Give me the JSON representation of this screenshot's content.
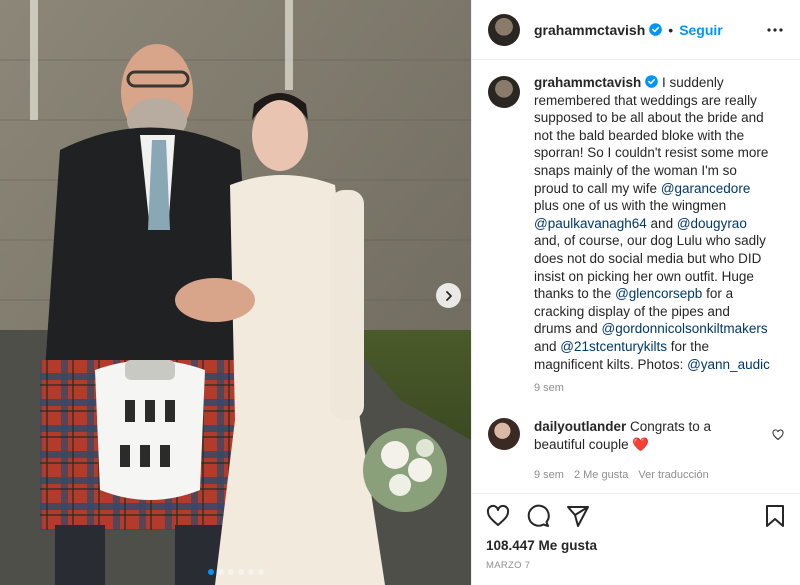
{
  "post": {
    "username": "grahammctavish",
    "follow_label": "Seguir",
    "caption_segments": [
      {
        "type": "text",
        "text": " I suddenly remembered that weddings are really supposed to be all about the bride and not the bald bearded bloke with the sporran! So I couldn't resist some more snaps mainly of the woman I'm so proud to call my wife "
      },
      {
        "type": "mention",
        "text": "@garancedore"
      },
      {
        "type": "text",
        "text": " plus one of us with the wingmen "
      },
      {
        "type": "mention",
        "text": "@paulkavanagh64"
      },
      {
        "type": "text",
        "text": " and "
      },
      {
        "type": "mention",
        "text": "@dougyrao"
      },
      {
        "type": "text",
        "text": " and, of course, our dog Lulu who sadly does not do social media but who DID insist on picking her own outfit. Huge thanks to the "
      },
      {
        "type": "mention",
        "text": "@glencorsepb"
      },
      {
        "type": "text",
        "text": " for a cracking display of the pipes and drums and "
      },
      {
        "type": "mention",
        "text": "@gordonnicolsonkiltmakers"
      },
      {
        "type": "text",
        "text": " and "
      },
      {
        "type": "mention",
        "text": "@21stcenturykilts"
      },
      {
        "type": "text",
        "text": " for the magnificent kilts. Photos: "
      },
      {
        "type": "mention",
        "text": "@yann_audic"
      }
    ],
    "caption_time": "9 sem",
    "likes": "108.447 Me gusta",
    "date": "MARZO 7"
  },
  "comment": {
    "username": "dailyoutlander",
    "text": " Congrats to a beautiful couple ",
    "emoji": "❤️",
    "time": "9 sem",
    "likes": "2 Me gusta",
    "translate": "Ver traducción"
  },
  "carousel": {
    "slide_count": 6,
    "active_index": 0
  },
  "icons": {
    "verified": "verified-badge-icon",
    "more": "more-options-icon",
    "next": "chevron-right-icon",
    "like": "heart-icon",
    "comment": "comment-bubble-icon",
    "share": "paper-plane-icon",
    "save": "bookmark-icon"
  },
  "colors": {
    "accent": "#0095f6",
    "mention": "#00376b",
    "muted": "#8e8e8e",
    "heart": "#ed4956"
  }
}
